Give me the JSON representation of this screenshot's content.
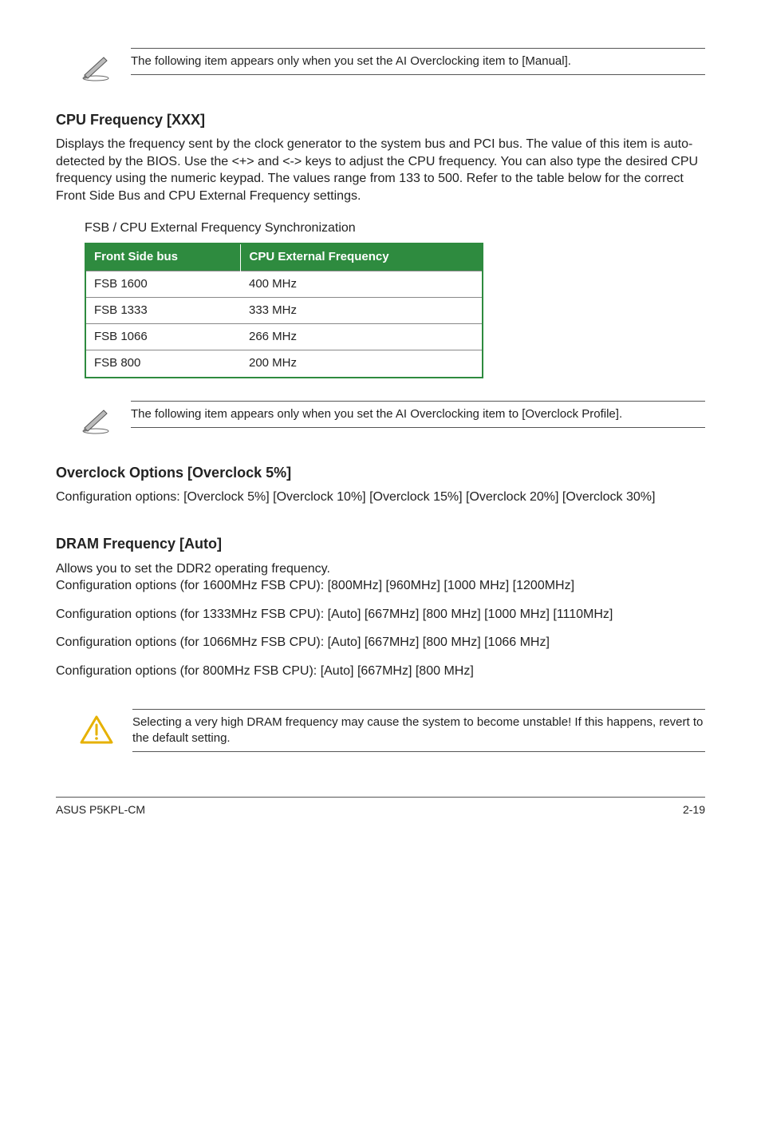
{
  "notes": {
    "manual": "The following item appears only when you set the AI Overclocking item to [Manual].",
    "overclock_profile": "The following item appears only when you set the AI Overclocking item to [Overclock Profile]."
  },
  "sections": {
    "cpu_freq": {
      "heading": "CPU Frequency [XXX]",
      "body": "Displays the frequency sent by the clock generator to the system bus and PCI bus. The value of this item is auto-detected by the BIOS. Use the <+> and <-> keys to adjust the CPU frequency. You can also type the desired CPU frequency using the numeric keypad. The values range from 133 to 500. Refer to the table below for the correct Front Side Bus and CPU External Frequency settings."
    },
    "overclock_options": {
      "heading": "Overclock Options [Overclock 5%]",
      "body": "Configuration options: [Overclock 5%] [Overclock 10%] [Overclock 15%] [Overclock 20%] [Overclock 30%]"
    },
    "dram_freq": {
      "heading": "DRAM Frequency [Auto]",
      "line1": "Allows you to set the DDR2 operating frequency.",
      "line2": "Configuration options (for 1600MHz FSB CPU): [800MHz] [960MHz] [1000 MHz] [1200MHz]",
      "line3": "Configuration options (for 1333MHz FSB CPU): [Auto] [667MHz] [800 MHz] [1000 MHz] [1110MHz]",
      "line4": "Configuration options (for 1066MHz FSB CPU): [Auto] [667MHz] [800 MHz] [1066 MHz]",
      "line5": "Configuration options (for 800MHz FSB CPU): [Auto] [667MHz] [800 MHz]"
    }
  },
  "table": {
    "caption": "FSB / CPU External Frequency Synchronization",
    "headers": {
      "col1": "Front Side bus",
      "col2": "CPU External Frequency"
    },
    "rows": [
      {
        "fsb": "FSB 1600",
        "freq": "400 MHz"
      },
      {
        "fsb": "FSB 1333",
        "freq": "333 MHz"
      },
      {
        "fsb": "FSB 1066",
        "freq": "266 MHz"
      },
      {
        "fsb": "FSB 800",
        "freq": "200 MHz"
      }
    ]
  },
  "warning": "Selecting a very high DRAM frequency may cause the system to become unstable! If this happens, revert to the default setting.",
  "footer": {
    "left": "ASUS P5KPL-CM",
    "right": "2-19"
  },
  "chart_data": {
    "type": "table",
    "title": "FSB / CPU External Frequency Synchronization",
    "columns": [
      "Front Side bus",
      "CPU External Frequency"
    ],
    "rows": [
      [
        "FSB 1600",
        "400 MHz"
      ],
      [
        "FSB 1333",
        "333 MHz"
      ],
      [
        "FSB 1066",
        "266 MHz"
      ],
      [
        "FSB 800",
        "200 MHz"
      ]
    ]
  }
}
